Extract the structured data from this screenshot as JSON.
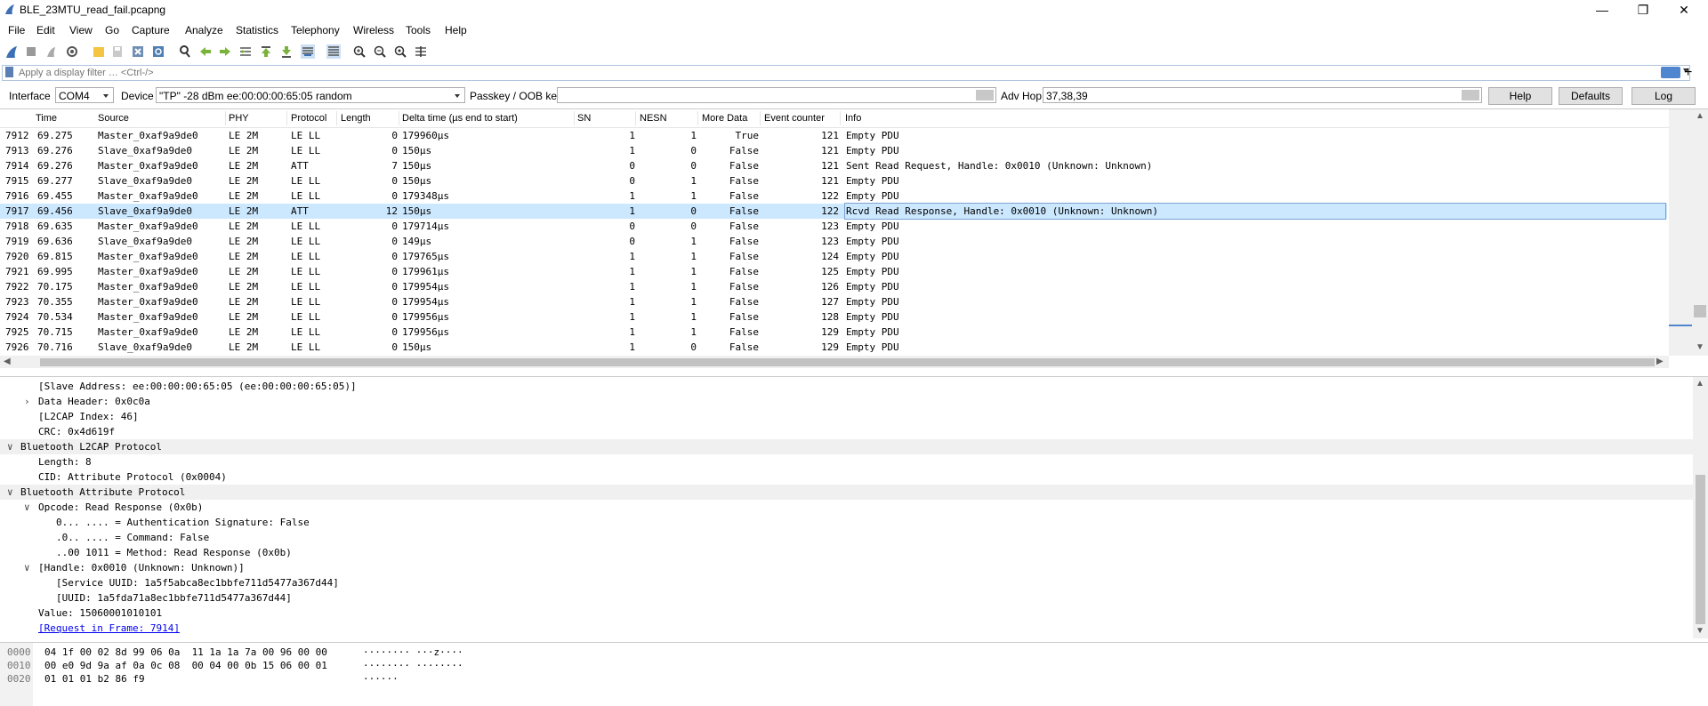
{
  "window": {
    "title": "BLE_23MTU_read_fail.pcapng"
  },
  "menu": [
    "File",
    "Edit",
    "View",
    "Go",
    "Capture",
    "Analyze",
    "Statistics",
    "Telephony",
    "Wireless",
    "Tools",
    "Help"
  ],
  "filter": {
    "placeholder": "Apply a display filter … <Ctrl-/>",
    "plus": "+"
  },
  "interface_bar": {
    "interface_label": "Interface",
    "interface_value": "COM4",
    "device_label": "Device",
    "device_value": "\"TP\"  -28 dBm  ee:00:00:00:65:05  random",
    "passkey_label": "Passkey / OOB key",
    "passkey_value": "",
    "advhop_label": "Adv Hop",
    "advhop_value": "37,38,39",
    "help": "Help",
    "defaults": "Defaults",
    "log": "Log"
  },
  "packet_list": {
    "columns": [
      "Time",
      "Source",
      "PHY",
      "Protocol",
      "Length",
      "Delta time (µs end to start)",
      "SN",
      "NESN",
      "More Data",
      "Event counter",
      "Info"
    ],
    "rows": [
      {
        "no": "7912",
        "time": "69.275",
        "src": "Master_0xaf9a9de0",
        "phy": "LE 2M",
        "proto": "LE LL",
        "len": "0",
        "delta": "179960µs",
        "sn": "1",
        "nesn": "1",
        "more": "True",
        "evt": "121",
        "info": "Empty PDU"
      },
      {
        "no": "7913",
        "time": "69.276",
        "src": "Slave_0xaf9a9de0",
        "phy": "LE 2M",
        "proto": "LE LL",
        "len": "0",
        "delta": "150µs",
        "sn": "1",
        "nesn": "0",
        "more": "False",
        "evt": "121",
        "info": "Empty PDU"
      },
      {
        "no": "7914",
        "time": "69.276",
        "src": "Master_0xaf9a9de0",
        "phy": "LE 2M",
        "proto": "ATT",
        "len": "7",
        "delta": "150µs",
        "sn": "0",
        "nesn": "0",
        "more": "False",
        "evt": "121",
        "info": "Sent Read Request, Handle: 0x0010 (Unknown: Unknown)"
      },
      {
        "no": "7915",
        "time": "69.277",
        "src": "Slave_0xaf9a9de0",
        "phy": "LE 2M",
        "proto": "LE LL",
        "len": "0",
        "delta": "150µs",
        "sn": "0",
        "nesn": "1",
        "more": "False",
        "evt": "121",
        "info": "Empty PDU"
      },
      {
        "no": "7916",
        "time": "69.455",
        "src": "Master_0xaf9a9de0",
        "phy": "LE 2M",
        "proto": "LE LL",
        "len": "0",
        "delta": "179348µs",
        "sn": "1",
        "nesn": "1",
        "more": "False",
        "evt": "122",
        "info": "Empty PDU"
      },
      {
        "no": "7917",
        "time": "69.456",
        "src": "Slave_0xaf9a9de0",
        "phy": "LE 2M",
        "proto": "ATT",
        "len": "12",
        "delta": "150µs",
        "sn": "1",
        "nesn": "0",
        "more": "False",
        "evt": "122",
        "info": "Rcvd Read Response, Handle: 0x0010 (Unknown: Unknown)",
        "selected": true
      },
      {
        "no": "7918",
        "time": "69.635",
        "src": "Master_0xaf9a9de0",
        "phy": "LE 2M",
        "proto": "LE LL",
        "len": "0",
        "delta": "179714µs",
        "sn": "0",
        "nesn": "0",
        "more": "False",
        "evt": "123",
        "info": "Empty PDU"
      },
      {
        "no": "7919",
        "time": "69.636",
        "src": "Slave_0xaf9a9de0",
        "phy": "LE 2M",
        "proto": "LE LL",
        "len": "0",
        "delta": "149µs",
        "sn": "0",
        "nesn": "1",
        "more": "False",
        "evt": "123",
        "info": "Empty PDU"
      },
      {
        "no": "7920",
        "time": "69.815",
        "src": "Master_0xaf9a9de0",
        "phy": "LE 2M",
        "proto": "LE LL",
        "len": "0",
        "delta": "179765µs",
        "sn": "1",
        "nesn": "1",
        "more": "False",
        "evt": "124",
        "info": "Empty PDU"
      },
      {
        "no": "7921",
        "time": "69.995",
        "src": "Master_0xaf9a9de0",
        "phy": "LE 2M",
        "proto": "LE LL",
        "len": "0",
        "delta": "179961µs",
        "sn": "1",
        "nesn": "1",
        "more": "False",
        "evt": "125",
        "info": "Empty PDU"
      },
      {
        "no": "7922",
        "time": "70.175",
        "src": "Master_0xaf9a9de0",
        "phy": "LE 2M",
        "proto": "LE LL",
        "len": "0",
        "delta": "179954µs",
        "sn": "1",
        "nesn": "1",
        "more": "False",
        "evt": "126",
        "info": "Empty PDU"
      },
      {
        "no": "7923",
        "time": "70.355",
        "src": "Master_0xaf9a9de0",
        "phy": "LE 2M",
        "proto": "LE LL",
        "len": "0",
        "delta": "179954µs",
        "sn": "1",
        "nesn": "1",
        "more": "False",
        "evt": "127",
        "info": "Empty PDU"
      },
      {
        "no": "7924",
        "time": "70.534",
        "src": "Master_0xaf9a9de0",
        "phy": "LE 2M",
        "proto": "LE LL",
        "len": "0",
        "delta": "179956µs",
        "sn": "1",
        "nesn": "1",
        "more": "False",
        "evt": "128",
        "info": "Empty PDU"
      },
      {
        "no": "7925",
        "time": "70.715",
        "src": "Master_0xaf9a9de0",
        "phy": "LE 2M",
        "proto": "LE LL",
        "len": "0",
        "delta": "179956µs",
        "sn": "1",
        "nesn": "1",
        "more": "False",
        "evt": "129",
        "info": "Empty PDU"
      },
      {
        "no": "7926",
        "time": "70.716",
        "src": "Slave_0xaf9a9de0",
        "phy": "LE 2M",
        "proto": "LE LL",
        "len": "0",
        "delta": "150µs",
        "sn": "1",
        "nesn": "0",
        "more": "False",
        "evt": "129",
        "info": "Empty PDU"
      }
    ]
  },
  "details": [
    {
      "indent": 2,
      "toggle": "",
      "text": "[Slave Address: ee:00:00:00:65:05 (ee:00:00:00:65:05)]"
    },
    {
      "indent": 2,
      "toggle": ">",
      "text": "Data Header: 0x0c0a"
    },
    {
      "indent": 2,
      "toggle": "",
      "text": "[L2CAP Index: 46]"
    },
    {
      "indent": 2,
      "toggle": "",
      "text": "CRC: 0x4d619f"
    },
    {
      "indent": 1,
      "toggle": "v",
      "text": "Bluetooth L2CAP Protocol",
      "hl": true
    },
    {
      "indent": 2,
      "toggle": "",
      "text": "Length: 8"
    },
    {
      "indent": 2,
      "toggle": "",
      "text": "CID: Attribute Protocol (0x0004)"
    },
    {
      "indent": 1,
      "toggle": "v",
      "text": "Bluetooth Attribute Protocol",
      "hl": true
    },
    {
      "indent": 2,
      "toggle": "v",
      "text": "Opcode: Read Response (0x0b)"
    },
    {
      "indent": 3,
      "toggle": "",
      "text": "0... .... = Authentication Signature: False"
    },
    {
      "indent": 3,
      "toggle": "",
      "text": ".0.. .... = Command: False"
    },
    {
      "indent": 3,
      "toggle": "",
      "text": "..00 1011 = Method: Read Response (0x0b)"
    },
    {
      "indent": 2,
      "toggle": "v",
      "text": "[Handle: 0x0010 (Unknown: Unknown)]"
    },
    {
      "indent": 3,
      "toggle": "",
      "text": "[Service UUID: 1a5f5abca8ec1bbfe711d5477a367d44]"
    },
    {
      "indent": 3,
      "toggle": "",
      "text": "[UUID: 1a5fda71a8ec1bbfe711d5477a367d44]"
    },
    {
      "indent": 2,
      "toggle": "",
      "text": "Value: 15060001010101"
    },
    {
      "indent": 2,
      "toggle": "",
      "text": "[Request in Frame: 7914]",
      "link": true
    }
  ],
  "bytes": [
    {
      "off": "0000",
      "hex": "04 1f 00 02 8d 99 06 0a  11 1a 1a 7a 00 96 00 00",
      "ascii": "········ ···z····"
    },
    {
      "off": "0010",
      "hex": "00 e0 9d 9a af 0a 0c 08  00 04 00 0b 15 06 00 01",
      "ascii": "········ ········"
    },
    {
      "off": "0020",
      "hex": "01 01 01 b2 86 f9",
      "ascii": "······"
    }
  ],
  "colors": {
    "accent": "#4f86cf",
    "selected_row": "#cce8ff",
    "fin": "#3c6fb5"
  },
  "icons": [
    "shark-fin-icon",
    "stop-icon",
    "restart-icon",
    "options-icon",
    "open-icon",
    "save-icon",
    "close-file-icon",
    "reload-icon",
    "find-icon",
    "back-icon",
    "forward-icon",
    "goto-icon",
    "first-icon",
    "last-icon",
    "autoscroll-icon",
    "colorize-icon",
    "zoom-in-icon",
    "zoom-out-icon",
    "zoom-reset-icon",
    "resize-columns-icon"
  ]
}
